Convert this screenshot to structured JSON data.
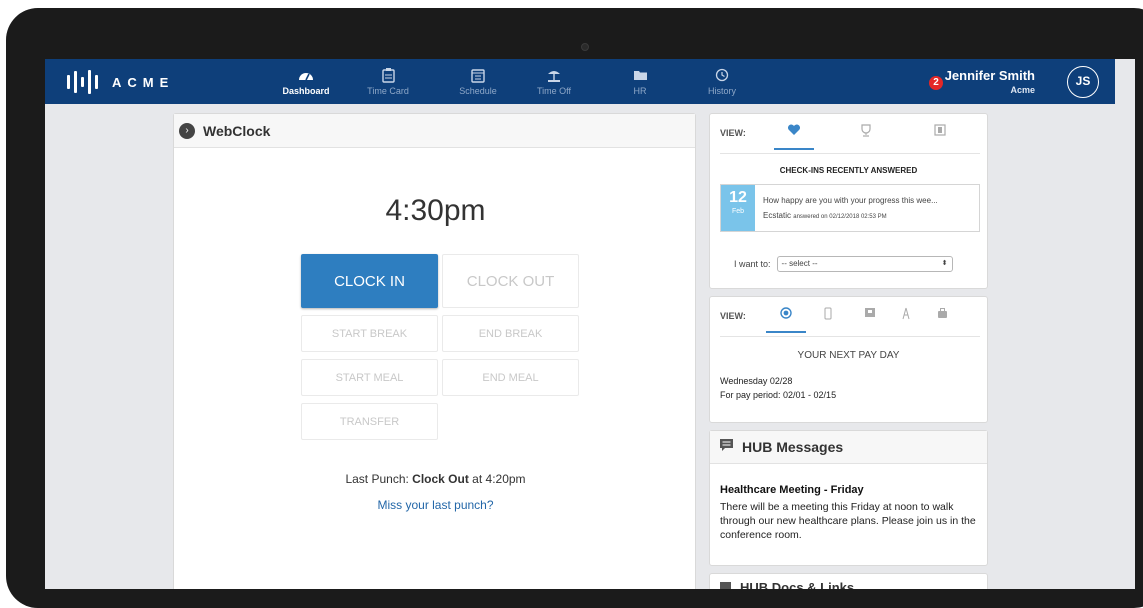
{
  "app": {
    "brand": "ACME"
  },
  "nav": {
    "items": [
      {
        "label": "Dashboard",
        "icon": "gauge-icon",
        "active": true
      },
      {
        "label": "Time Card",
        "icon": "timecard-icon",
        "active": false
      },
      {
        "label": "Schedule",
        "icon": "calendar-icon",
        "active": false
      },
      {
        "label": "Time Off",
        "icon": "beach-icon",
        "active": false
      },
      {
        "label": "HR",
        "icon": "folder-icon",
        "active": false
      },
      {
        "label": "History",
        "icon": "history-icon",
        "active": false
      }
    ],
    "notifications": "2",
    "user": {
      "name": "Jennifer Smith",
      "org": "Acme",
      "initials": "JS"
    }
  },
  "webclock": {
    "title": "WebClock",
    "time": "4:30pm",
    "buttons": {
      "clock_in": "CLOCK IN",
      "clock_out": "CLOCK OUT",
      "start_break": "START BREAK",
      "end_break": "END BREAK",
      "start_meal": "START MEAL",
      "end_meal": "END MEAL",
      "transfer": "TRANSFER"
    },
    "last_punch": {
      "prefix": "Last Punch: ",
      "value": "Clock Out",
      "suffix": " at 4:20pm"
    },
    "miss_link": "Miss your last punch?"
  },
  "checkins": {
    "view_label": "VIEW:",
    "title": "CHECK-INS RECENTLY ANSWERED",
    "card": {
      "day": "12",
      "month": "Feb",
      "question": "How happy are you with your progress this wee...",
      "answer": "Ecstatic",
      "answered_meta": "answered on 02/12/2018 02:53 PM"
    },
    "want_label": "I want to:",
    "select_value": "-- select --"
  },
  "payday": {
    "view_label": "VIEW:",
    "title": "YOUR NEXT PAY DAY",
    "date": "Wednesday 02/28",
    "period": "For pay period: 02/01 - 02/15"
  },
  "hub": {
    "title": "HUB Messages",
    "message_title": "Healthcare Meeting - Friday",
    "message_body": "There will be a meeting this Friday at noon to walk through our new healthcare plans. Please join us in the conference room."
  },
  "hub2": {
    "title": "HUB Docs & Links"
  },
  "colors": {
    "nav_bg": "#0e3f7a",
    "primary_button": "#2e7ec0",
    "date_box": "#7ac4ea",
    "badge": "#e42727",
    "link": "#2367a8"
  }
}
